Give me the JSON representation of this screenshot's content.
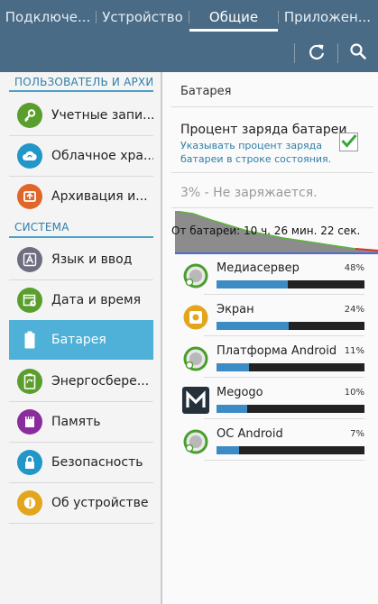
{
  "tabs": [
    {
      "label": "Подключе...",
      "active": false
    },
    {
      "label": "Устройство",
      "active": false
    },
    {
      "label": "Общие",
      "active": true
    },
    {
      "label": "Приложен...",
      "active": false
    }
  ],
  "sidebar": {
    "sections": [
      {
        "header": "ПОЛЬЗОВАТЕЛЬ И АРХИВ...",
        "items": [
          {
            "label": "Учетные запи...",
            "icon": "key-icon",
            "color": "#5a9e2e"
          },
          {
            "label": "Облачное хра...",
            "icon": "cloud-sync-icon",
            "color": "#2196c8"
          },
          {
            "label": "Архивация и...",
            "icon": "backup-icon",
            "color": "#e0662a"
          }
        ]
      },
      {
        "header": "СИСТЕМА",
        "items": [
          {
            "label": "Язык и ввод",
            "icon": "language-icon",
            "color": "#6e6e80"
          },
          {
            "label": "Дата и время",
            "icon": "calendar-clock-icon",
            "color": "#5a9e2e"
          },
          {
            "label": "Батарея",
            "icon": "battery-icon",
            "color": "#4fb0d8",
            "selected": true
          },
          {
            "label": "Энергосбере...",
            "icon": "power-saving-icon",
            "color": "#5a9e2e"
          },
          {
            "label": "Память",
            "icon": "storage-icon",
            "color": "#8a2c9e"
          },
          {
            "label": "Безопасность",
            "icon": "lock-icon",
            "color": "#2196c8"
          },
          {
            "label": "Об устройстве",
            "icon": "info-icon",
            "color": "#e3a51c"
          }
        ]
      }
    ]
  },
  "battery": {
    "title": "Батарея",
    "percent_option": {
      "title": "Процент заряда батареи",
      "subtitle": "Указывать процент заряда батареи в строке состояния.",
      "checked": true
    },
    "status": "3% - Не заряжается.",
    "graph_label": "От батареи: 10 ч. 26 мин. 22 сек.",
    "apps": [
      {
        "name": "Медиасервер",
        "percent": "48%",
        "value": 0.48,
        "icon": "android-gear-icon"
      },
      {
        "name": "Экран",
        "percent": "24%",
        "value": 0.49,
        "icon": "screen-brightness-icon"
      },
      {
        "name": "Платформа Android",
        "percent": "11%",
        "value": 0.22,
        "icon": "android-gear-icon"
      },
      {
        "name": "Megogo",
        "percent": "10%",
        "value": 0.21,
        "icon": "megogo-logo-icon"
      },
      {
        "name": "ОС Android",
        "percent": "7%",
        "value": 0.15,
        "icon": "android-gear-icon"
      }
    ]
  }
}
